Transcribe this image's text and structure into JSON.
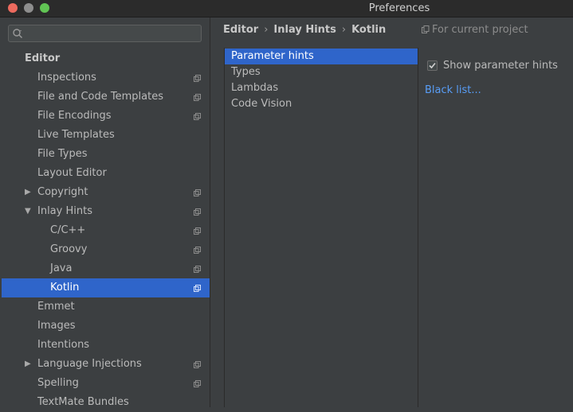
{
  "window": {
    "title": "Preferences"
  },
  "search": {
    "placeholder": ""
  },
  "tree": {
    "header": "Editor",
    "items": [
      {
        "label": "Inspections",
        "level": 1,
        "arrow": "",
        "copy": true,
        "selected": false
      },
      {
        "label": "File and Code Templates",
        "level": 1,
        "arrow": "",
        "copy": true,
        "selected": false
      },
      {
        "label": "File Encodings",
        "level": 1,
        "arrow": "",
        "copy": true,
        "selected": false
      },
      {
        "label": "Live Templates",
        "level": 1,
        "arrow": "",
        "copy": false,
        "selected": false
      },
      {
        "label": "File Types",
        "level": 1,
        "arrow": "",
        "copy": false,
        "selected": false
      },
      {
        "label": "Layout Editor",
        "level": 1,
        "arrow": "",
        "copy": false,
        "selected": false
      },
      {
        "label": "Copyright",
        "level": 1,
        "arrow": "collapsed",
        "copy": true,
        "selected": false
      },
      {
        "label": "Inlay Hints",
        "level": 1,
        "arrow": "expanded",
        "copy": true,
        "selected": false
      },
      {
        "label": "C/C++",
        "level": 2,
        "arrow": "",
        "copy": true,
        "selected": false
      },
      {
        "label": "Groovy",
        "level": 2,
        "arrow": "",
        "copy": true,
        "selected": false
      },
      {
        "label": "Java",
        "level": 2,
        "arrow": "",
        "copy": true,
        "selected": false
      },
      {
        "label": "Kotlin",
        "level": 2,
        "arrow": "",
        "copy": true,
        "selected": true
      },
      {
        "label": "Emmet",
        "level": 1,
        "arrow": "",
        "copy": false,
        "selected": false
      },
      {
        "label": "Images",
        "level": 1,
        "arrow": "",
        "copy": false,
        "selected": false
      },
      {
        "label": "Intentions",
        "level": 1,
        "arrow": "",
        "copy": false,
        "selected": false
      },
      {
        "label": "Language Injections",
        "level": 1,
        "arrow": "collapsed",
        "copy": true,
        "selected": false
      },
      {
        "label": "Spelling",
        "level": 1,
        "arrow": "",
        "copy": true,
        "selected": false
      },
      {
        "label": "TextMate Bundles",
        "level": 1,
        "arrow": "",
        "copy": false,
        "selected": false
      }
    ]
  },
  "breadcrumb": {
    "part1": "Editor",
    "sep1": "›",
    "part2": "Inlay Hints",
    "sep2": "›",
    "part3": "Kotlin"
  },
  "scope": {
    "label": "For current project"
  },
  "hints": {
    "items": [
      {
        "label": "Parameter hints",
        "selected": true
      },
      {
        "label": "Types",
        "selected": false
      },
      {
        "label": "Lambdas",
        "selected": false
      },
      {
        "label": "Code Vision",
        "selected": false
      }
    ]
  },
  "options": {
    "show_parameter_hints_label": "Show parameter hints",
    "show_parameter_hints_checked": true,
    "black_list_link": "Black list..."
  },
  "colors": {
    "accent": "#2f65ca",
    "link": "#589df6",
    "background": "#3c3f41"
  },
  "icons": {
    "search": "search-icon",
    "copy": "copy-icon",
    "arrow_collapsed": "arrow-right-icon",
    "arrow_expanded": "arrow-down-icon",
    "check": "check-icon"
  }
}
